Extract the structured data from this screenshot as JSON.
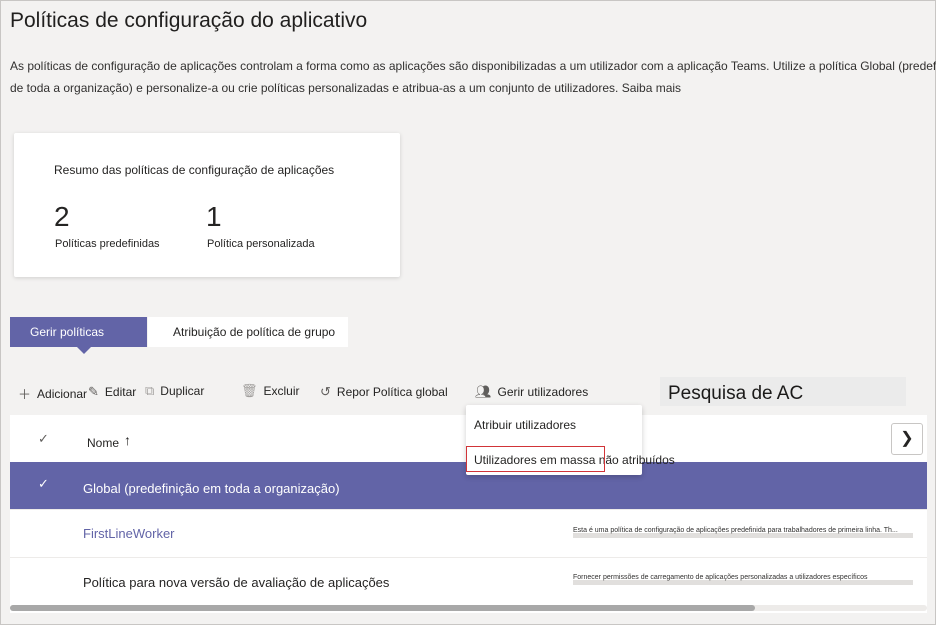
{
  "page": {
    "title": "Políticas de configuração do aplicativo",
    "description_line1": "As políticas de configuração de aplicações controlam a forma como as aplicações são disponibilizadas a um utilizador com a aplicação Teams. Utilize a política Global (predefinição",
    "description_line2": "de toda a organização) e personalize-a ou crie políticas personalizadas e atribua-as a um conjunto de utilizadores. Saiba mais"
  },
  "summary": {
    "title": "Resumo das políticas de configuração de aplicações",
    "stats": [
      {
        "value": "2",
        "label": "Políticas predefinidas"
      },
      {
        "value": "1",
        "label": "Política personalizada"
      }
    ]
  },
  "tabs": [
    {
      "label": "Gerir políticas",
      "active": true
    },
    {
      "label": "Atribuição de política de grupo",
      "active": false
    }
  ],
  "toolbar": {
    "add": "Adicionar",
    "edit": "Editar",
    "duplicate": "Duplicar",
    "delete": "Excluir",
    "reset": "Repor Política global",
    "manage_users": "Gerir utilizadores",
    "icons": {
      "add": "plus-icon",
      "edit": "pencil-icon",
      "duplicate": "copy-icon",
      "delete": "trash-icon",
      "reset": "reset-icon",
      "manage_users": "people-icon"
    }
  },
  "search": {
    "value": "Pesquisa de AC"
  },
  "dropdown": {
    "items": [
      "Atribuir utilizadores",
      "Utilizadores em massa não atribuídos"
    ]
  },
  "table": {
    "columns": {
      "check": "✓",
      "name": "Nome",
      "sort": "↑"
    },
    "rows": [
      {
        "name": "Global (predefinição em toda a organização)",
        "description": "",
        "selected": true
      },
      {
        "name": "FirstLineWorker",
        "description": "Esta é uma política de configuração de aplicações predefinida para trabalhadores de primeira linha. Th...",
        "selected": false
      },
      {
        "name": "Política para nova versão de avaliação de aplicações",
        "description": "Fornecer permissões de carregamento de aplicações personalizadas a utilizadores específicos",
        "selected": false
      }
    ]
  },
  "colors": {
    "accent": "#6264a7",
    "highlight_border": "#d13438",
    "background": "#f3f2f1"
  }
}
